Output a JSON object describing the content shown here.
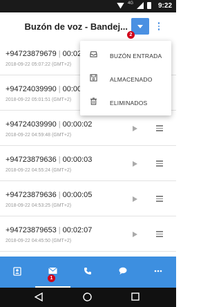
{
  "status_bar": {
    "network": "4G",
    "time": "9:22"
  },
  "header": {
    "title": "Buzón de voz - Bandej..."
  },
  "badges": {
    "dropdown": "2",
    "mail_tab": "1"
  },
  "dropdown_menu": {
    "items": [
      {
        "label": "BUZÓN ENTRADA",
        "icon": "inbox-icon"
      },
      {
        "label": "ALMACENADO",
        "icon": "save-icon"
      },
      {
        "label": "ELIMINADOS",
        "icon": "trash-icon"
      }
    ]
  },
  "messages": [
    {
      "number": "+94723879679",
      "duration": "00:02:0",
      "datetime": "2018-09-22 05:07:22 (GMT+2)"
    },
    {
      "number": "+94724039990",
      "duration": "00:00:0",
      "datetime": "2018-09-22 05:01:51 (GMT+2)"
    },
    {
      "number": "+94724039990",
      "duration": "00:00:02",
      "datetime": "2018-09-22 04:59:48 (GMT+2)"
    },
    {
      "number": "+94723879636",
      "duration": "00:00:03",
      "datetime": "2018-09-22 04:55:24 (GMT+2)"
    },
    {
      "number": "+94723879636",
      "duration": "00:00:05",
      "datetime": "2018-09-22 04:53:25 (GMT+2)"
    },
    {
      "number": "+94723879653",
      "duration": "00:02:07",
      "datetime": "2018-09-22 04:45:50 (GMT+2)"
    }
  ],
  "bottom_nav": {
    "tabs": [
      {
        "icon": "contacts-icon"
      },
      {
        "icon": "mail-icon",
        "active": true
      },
      {
        "icon": "phone-icon"
      },
      {
        "icon": "chat-icon"
      },
      {
        "icon": "more-icon"
      }
    ]
  },
  "colors": {
    "accent": "#3d8fe0",
    "badge": "#d0021b"
  }
}
